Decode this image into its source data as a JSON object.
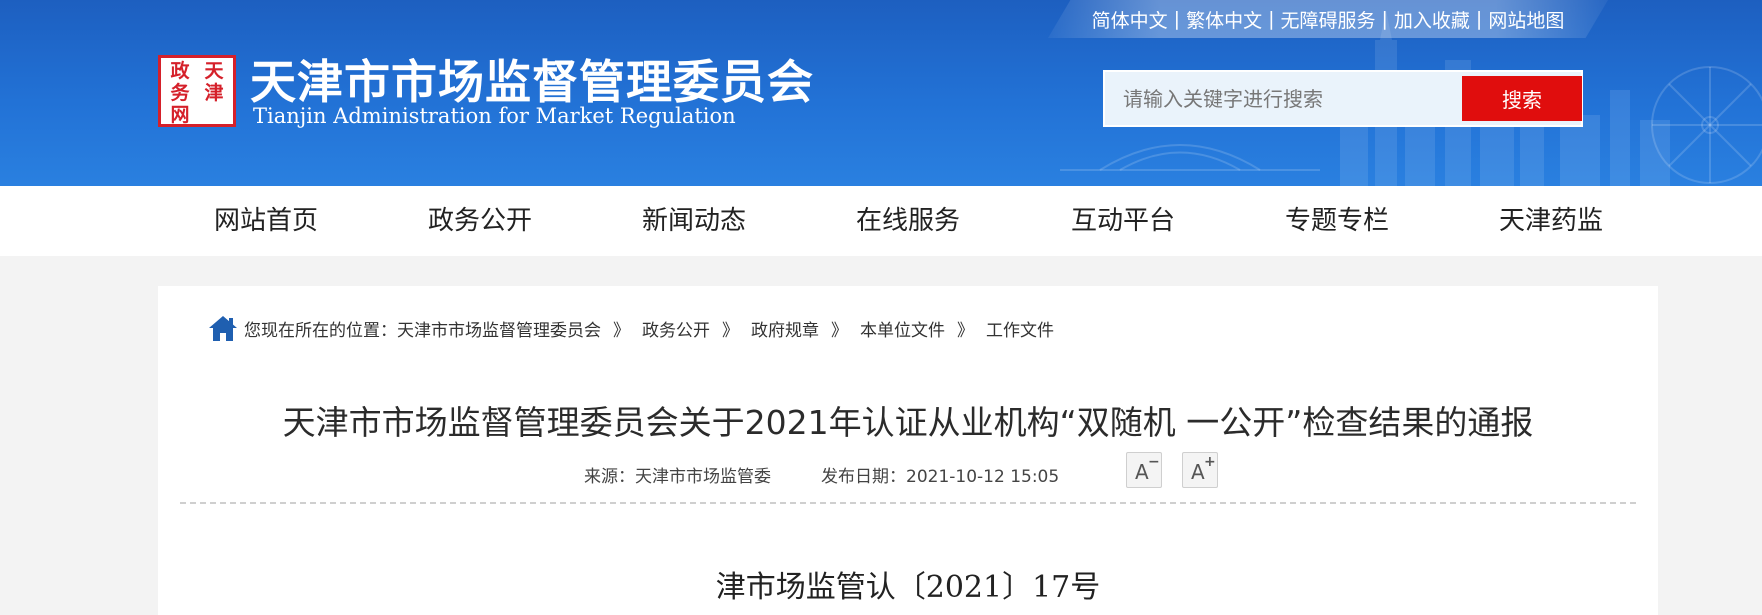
{
  "header": {
    "top_links": [
      "简体中文",
      "繁体中文",
      "无障碍服务",
      "加入收藏",
      "网站地图"
    ],
    "logo_seal_chars": [
      "天",
      "政",
      "津",
      "务",
      "网",
      ""
    ],
    "logo_title_cn": "天津市市场监督管理委员会",
    "logo_title_en": "Tianjin Administration for Market Regulation",
    "search": {
      "placeholder": "请输入关键字进行搜索",
      "button_label": "搜索"
    }
  },
  "nav": {
    "items": [
      "网站首页",
      "政务公开",
      "新闻动态",
      "在线服务",
      "互动平台",
      "专题专栏",
      "天津药监"
    ]
  },
  "breadcrumb": {
    "prefix": "您现在所在的位置：",
    "items": [
      "天津市市场监督管理委员会",
      "政务公开",
      "政府规章",
      "本单位文件",
      "工作文件"
    ],
    "separator": "》"
  },
  "article": {
    "title": "天津市市场监督管理委员会关于2021年认证从业机构“双随机 一公开”检查结果的通报",
    "source": "来源：天津市市场监管委",
    "publish_date": "发布日期：2021-10-12 15:05",
    "font_decrease_label": "A",
    "font_decrease_mark": "−",
    "font_increase_label": "A",
    "font_increase_mark": "+",
    "doc_number": "津市场监管认〔2021〕17号"
  },
  "colors": {
    "header_blue": "#1d5fc0",
    "search_button_red": "#e00d0d",
    "seal_red": "#d5202a"
  }
}
